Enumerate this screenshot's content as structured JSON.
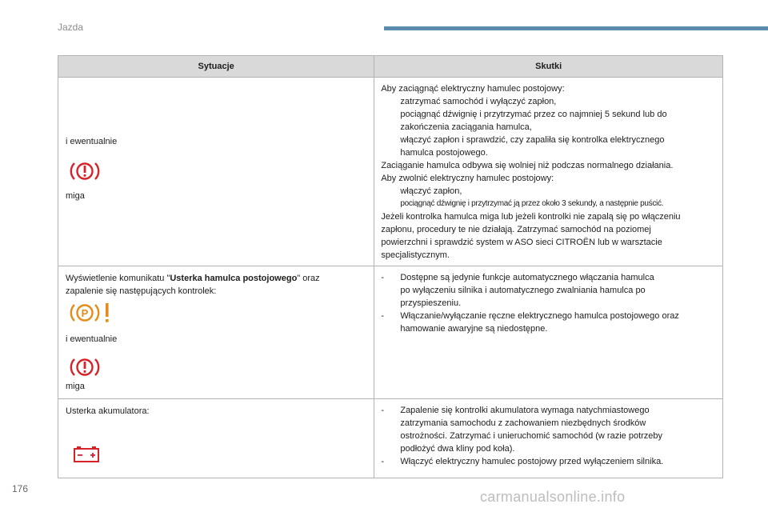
{
  "header": {
    "section": "Jazda",
    "page": "176"
  },
  "watermark": "carmanualsonline.info",
  "table": {
    "col1": "Sytuacje",
    "col2": "Skutki",
    "row1": {
      "left": {
        "and_or": "i ewentualnie",
        "blink": "miga"
      },
      "right": {
        "intro": "Aby zaciągnąć elektryczny hamulec postojowy:",
        "b1": "zatrzymać samochód i wyłączyć zapłon,",
        "b2a": "pociągnąć dźwignię i przytrzymać przez co najmniej 5 sekund lub do",
        "b2b": "zakończenia zaciągania hamulca,",
        "b3a": "włączyć zapłon i sprawdzić, czy zapaliła się kontrolka elektrycznego",
        "b3b": "hamulca postojowego.",
        "p2": "Zaciąganie hamulca odbywa się wolniej niż podczas normalnego działania.",
        "p3": "Aby zwolnić elektryczny hamulec postojowy:",
        "b4": "włączyć zapłon,",
        "b5": "pociągnąć dźwignię i przytrzymać ją przez około 3 sekundy, a następnie puścić.",
        "p4a": "Jeżeli kontrolka hamulca miga lub jeżeli kontrolki nie zapalą się po włączeniu",
        "p4b": "zapłonu, procedury te nie działają. Zatrzymać samochód na poziomej",
        "p4c": "powierzchni i sprawdzić system w ASO sieci CITROËN lub w warsztacie",
        "p4d": "specjalistycznym."
      }
    },
    "row2": {
      "left": {
        "l1_pre": "Wyświetlenie komunikatu \"",
        "l1_bold": "Usterka hamulca postojowego",
        "l1_post": "\" oraz",
        "l2": "zapalenie się następujących kontrolek:",
        "and_or": "i ewentualnie",
        "blink": "miga"
      },
      "right": {
        "b1a": "Dostępne są jedynie funkcje automatycznego włączania hamulca",
        "b1b": "po wyłączeniu silnika i automatycznego zwalniania hamulca po",
        "b1c": "przyspieszeniu.",
        "b2a": "Włączanie/wyłączanie ręczne elektrycznego hamulca postojowego oraz",
        "b2b": "hamowanie awaryjne są niedostępne."
      }
    },
    "row3": {
      "left": {
        "label": "Usterka akumulatora:"
      },
      "right": {
        "b1a": "Zapalenie się kontrolki akumulatora wymaga natychmiastowego",
        "b1b": "zatrzymania samochodu z zachowaniem niezbędnych środków",
        "b1c": "ostrożności. Zatrzymać i unieruchomić samochód (w razie potrzeby",
        "b1d": "podłożyć dwa kliny pod koła).",
        "b2": "Włączyć elektryczny hamulec postojowy przed wyłączeniem silnika."
      }
    }
  },
  "glyphs": {
    "arrow": "",
    "dash": "-"
  },
  "colors": {
    "warning": "#d6232a",
    "header_bar": "#5b8bad"
  }
}
